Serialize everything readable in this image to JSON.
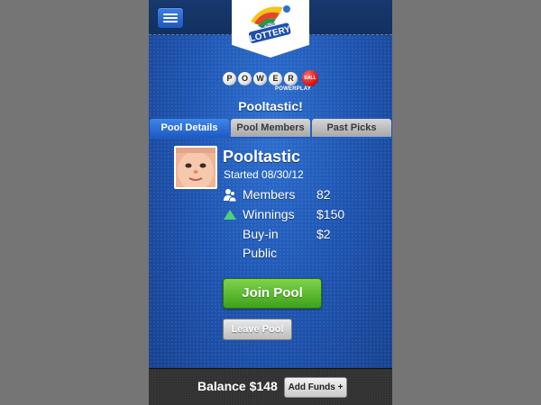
{
  "header": {
    "menu_icon": "hamburger-menu-icon",
    "logo_name": "illinois-lottery-logo",
    "logo_text": "LOTTERY",
    "logo_state_text": "ILLINOIS"
  },
  "game": {
    "logo_letters": [
      "P",
      "O",
      "W",
      "E",
      "R"
    ],
    "logo_ball_text": "BALL",
    "logo_sub_text": "POWERPLAY"
  },
  "pool": {
    "heading": "Pooltastic!",
    "name": "Pooltastic",
    "started": "Started 08/30/12",
    "avatar_icon": "baby-photo-avatar"
  },
  "tabs": [
    {
      "label": "Pool Details",
      "active": true
    },
    {
      "label": "Pool Members",
      "active": false
    },
    {
      "label": "Past Picks",
      "active": false
    }
  ],
  "details": [
    {
      "icon": "members-icon",
      "label": "Members",
      "value": "82"
    },
    {
      "icon": "trend-up-triangle-icon",
      "label": "Winnings",
      "value": "$150"
    },
    {
      "icon": "",
      "label": "Buy-in",
      "value": "$2"
    },
    {
      "icon": "",
      "label": "Public",
      "value": ""
    }
  ],
  "actions": {
    "join_label": "Join Pool",
    "leave_label": "Leave Pool"
  },
  "footer": {
    "balance_label": "Balance $148",
    "add_funds_label": "Add Funds +"
  },
  "colors": {
    "page_bg": "#757575",
    "panel_blue": "#1f56b3",
    "tab_active": "#2a70d6",
    "join_green": "#4fb423",
    "winnings_icon": "#4fd07a"
  }
}
